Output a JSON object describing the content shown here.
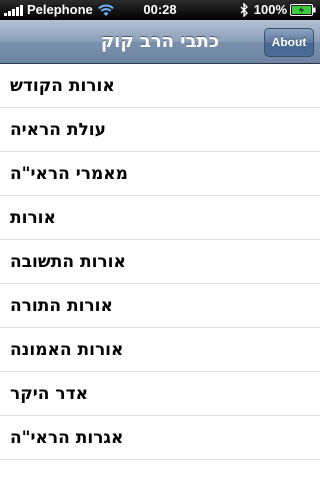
{
  "status_bar": {
    "carrier": "Pelephone",
    "time": "00:28",
    "battery_percent": "100%",
    "icons": [
      "signal-icon",
      "wifi-icon",
      "bluetooth-icon",
      "battery-icon"
    ]
  },
  "nav_bar": {
    "title": "כתבי הרב קוק",
    "about_label": "About"
  },
  "list": {
    "items": [
      {
        "label": "אורות הקודש"
      },
      {
        "label": "עולת הראיה"
      },
      {
        "label": "מאמרי הראי\"ה"
      },
      {
        "label": "אורות"
      },
      {
        "label": "אורות התשובה"
      },
      {
        "label": "אורות התורה"
      },
      {
        "label": "אורות האמונה"
      },
      {
        "label": "אדר היקר"
      },
      {
        "label": "אגרות הראי\"ה"
      },
      {
        "label": "...."
      }
    ]
  },
  "colors": {
    "nav_bar": "#7b90ad",
    "button": "#4b6b96",
    "separator": "#e0e0e0"
  }
}
